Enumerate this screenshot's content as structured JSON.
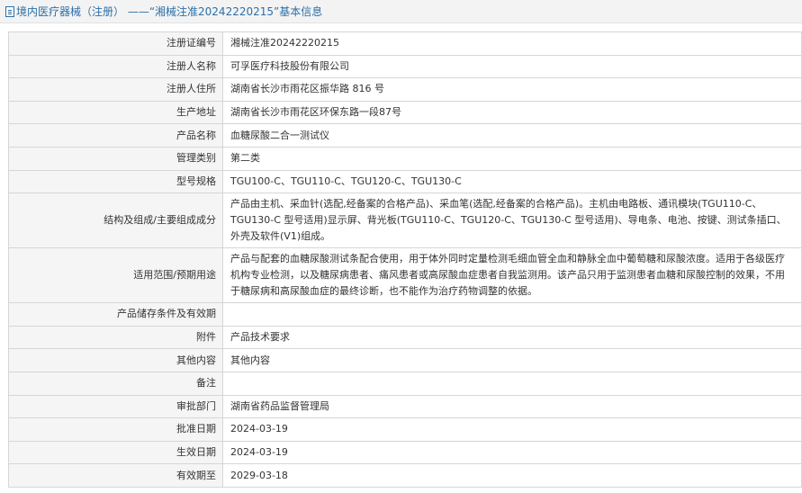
{
  "header": {
    "icon": "document-icon",
    "title": "境内医疗器械（注册） ——“湘械注准20242220215”基本信息"
  },
  "rows": [
    {
      "label": "注册证编号",
      "value": "湘械注准20242220215"
    },
    {
      "label": "注册人名称",
      "value": "可孚医疗科技股份有限公司"
    },
    {
      "label": "注册人住所",
      "value": "湖南省长沙市雨花区振华路 816 号"
    },
    {
      "label": "生产地址",
      "value": "湖南省长沙市雨花区环保东路一段87号"
    },
    {
      "label": "产品名称",
      "value": "血糖尿酸二合一测试仪"
    },
    {
      "label": "管理类别",
      "value": "第二类"
    },
    {
      "label": "型号规格",
      "value": "TGU100-C、TGU110-C、TGU120-C、TGU130-C"
    },
    {
      "label": "结构及组成/主要组成成分",
      "value": "产品由主机、采血针(选配,经备案的合格产品)、采血笔(选配,经备案的合格产品)。主机由电路板、通讯模块(TGU110-C、TGU130-C 型号适用)显示屏、背光板(TGU110-C、TGU120-C、TGU130-C 型号适用)、导电条、电池、按键、测试条插口、外壳及软件(V1)组成。"
    },
    {
      "label": "适用范围/预期用途",
      "value": "产品与配套的血糖尿酸测试条配合使用，用于体外同时定量检测毛细血管全血和静脉全血中葡萄糖和尿酸浓度。适用于各级医疗机构专业检测，以及糖尿病患者、痛风患者或高尿酸血症患者自我监测用。该产品只用于监测患者血糖和尿酸控制的效果，不用于糖尿病和高尿酸血症的最终诊断，也不能作为治疗药物调整的依据。"
    },
    {
      "label": "产品储存条件及有效期",
      "value": ""
    },
    {
      "label": "附件",
      "value": "产品技术要求"
    },
    {
      "label": "其他内容",
      "value": "其他内容"
    },
    {
      "label": "备注",
      "value": ""
    },
    {
      "label": "审批部门",
      "value": "湖南省药品监督管理局"
    },
    {
      "label": "批准日期",
      "value": "2024-03-19"
    },
    {
      "label": "生效日期",
      "value": "2024-03-19"
    },
    {
      "label": "有效期至",
      "value": "2029-03-18"
    }
  ]
}
